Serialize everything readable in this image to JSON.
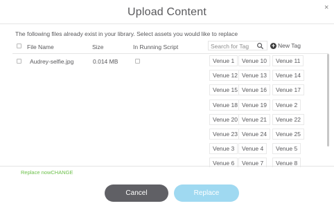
{
  "dialog": {
    "title": "Upload Content",
    "close_glyph": "×",
    "notice": "The following files already exist in your library. Select assets you would like to replace"
  },
  "table": {
    "headers": {
      "file_name": "File Name",
      "size": "Size",
      "in_running_script": "In Running Script"
    },
    "rows": [
      {
        "file_name": "Audrey-selfie.jpg",
        "size": "0.014 MB",
        "in_running_script": false,
        "selected": false
      }
    ]
  },
  "tags": {
    "search_placeholder": "Search for Tag",
    "new_tag_label": "New Tag",
    "items": [
      "Venue 1",
      "Venue 10",
      "Venue 11",
      "Venue 12",
      "Venue 13",
      "Venue 14",
      "Venue 15",
      "Venue 16",
      "Venue 17",
      "Venue 18",
      "Venue 19",
      "Venue 2",
      "Venue 20",
      "Venue 21",
      "Venue 22",
      "Venue 23",
      "Venue 24",
      "Venue 25",
      "Venue 3",
      "Venue 4",
      "Venue 5",
      "Venue 6",
      "Venue 7",
      "Venue 8"
    ]
  },
  "footer": {
    "replace_now": "Replace now",
    "change": "CHANGE",
    "cancel_label": "Cancel",
    "replace_label": "Replace"
  },
  "colors": {
    "accent_green": "#6cc04a",
    "replace_button": "#9fd9f1",
    "cancel_button": "#606065"
  }
}
